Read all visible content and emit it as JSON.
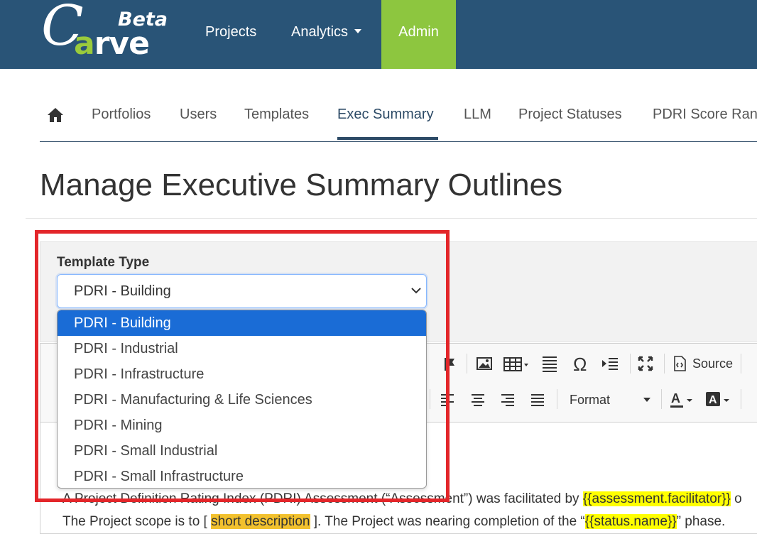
{
  "navbar": {
    "logo": {
      "letter_c": "C",
      "rest": "arve",
      "letter_a": "a",
      "badge": "Beta"
    },
    "links": {
      "projects": "Projects",
      "analytics": "Analytics",
      "admin": "Admin"
    }
  },
  "admin_tabs": {
    "home_icon": "home-icon",
    "items": [
      "Portfolios",
      "Users",
      "Templates",
      "Exec Summary",
      "LLM",
      "Project Statuses",
      "PDRI Score Ran"
    ],
    "active": "Exec Summary"
  },
  "page": {
    "title": "Manage Executive Summary Outlines"
  },
  "form": {
    "template_type_label": "Template Type",
    "selected_value": "PDRI - Building",
    "options": [
      "PDRI - Building",
      "PDRI - Industrial",
      "PDRI - Infrastructure",
      "PDRI - Manufacturing & Life Sciences",
      "PDRI - Mining",
      "PDRI - Small Industrial",
      "PDRI - Small Infrastructure"
    ]
  },
  "editor": {
    "toolbar": {
      "source_label": "Source",
      "format_label": "Format",
      "icons": [
        "flag-icon",
        "image-icon",
        "table-icon",
        "horizontal-line-icon",
        "omega-icon",
        "indent-icon",
        "maximize-icon",
        "source-icon",
        "align-left-icon",
        "align-center-icon",
        "align-right-icon",
        "justify-icon",
        "text-color-icon",
        "background-color-icon"
      ]
    },
    "body": {
      "line1_start": "A Project Definition Rating Index (PDRI) Assessment (“Assessment”) was facilitated by ",
      "line1_token": "{{assessment.facilitator}}",
      "line1_end": " o",
      "line2_start": "The Project scope is to [ ",
      "line2_placeholder": "short description",
      "line2_mid": " ].  The Project was nearing completion of the “",
      "line2_token": "{{status.name}}",
      "line2_end": "” phase."
    }
  },
  "colors": {
    "navbar": "#295477",
    "admin_active": "#8dc63f",
    "selected_option": "#1a6cd6",
    "annotation": "#e3262a",
    "token_highlight": "#ffff00",
    "placeholder_highlight": "#f2c12e"
  }
}
